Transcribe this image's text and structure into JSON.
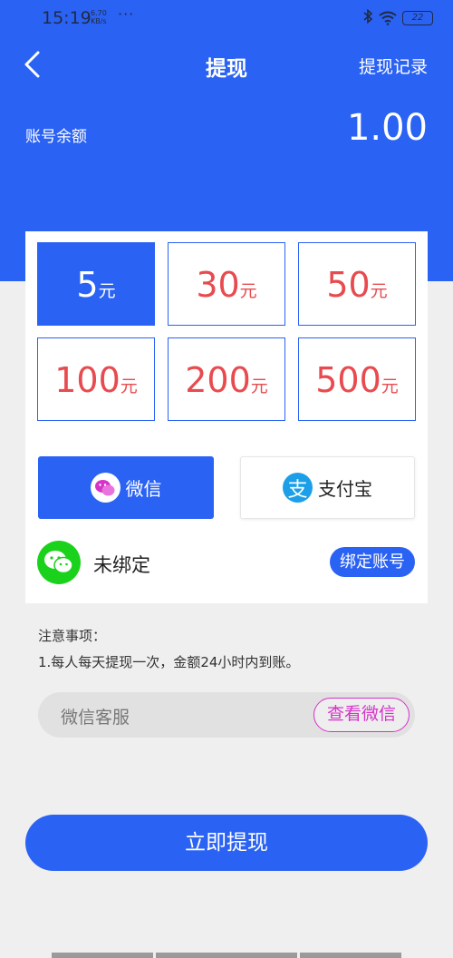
{
  "status_bar": {
    "time": "15:19",
    "speed_value": "6.70",
    "speed_unit": "KB/s",
    "dots": "···",
    "battery": "22"
  },
  "header": {
    "title": "提现",
    "record_link": "提现记录",
    "balance_label": "账号余额",
    "balance_value": "1.00"
  },
  "amounts": [
    {
      "value": "5",
      "unit": "元",
      "selected": true
    },
    {
      "value": "30",
      "unit": "元",
      "selected": false
    },
    {
      "value": "50",
      "unit": "元",
      "selected": false
    },
    {
      "value": "100",
      "unit": "元",
      "selected": false
    },
    {
      "value": "200",
      "unit": "元",
      "selected": false
    },
    {
      "value": "500",
      "unit": "元",
      "selected": false
    }
  ],
  "payment": {
    "wechat_label": "微信",
    "alipay_label": "支付宝",
    "alipay_icon_char": "支",
    "selected": "wechat"
  },
  "bind": {
    "status": "未绑定",
    "button": "绑定账号"
  },
  "notes": {
    "title": "注意事项：",
    "lines": [
      "1.每人每天提现一次，金额24小时内到账。"
    ]
  },
  "service": {
    "label": "微信客服",
    "button": "查看微信"
  },
  "submit_label": "立即提现",
  "colors": {
    "primary": "#2a62f4",
    "amount_text": "#e84b4f",
    "wechat_green": "#1ad21b",
    "accent_pink": "#d633c9",
    "alipay_blue": "#1c9fe8"
  }
}
